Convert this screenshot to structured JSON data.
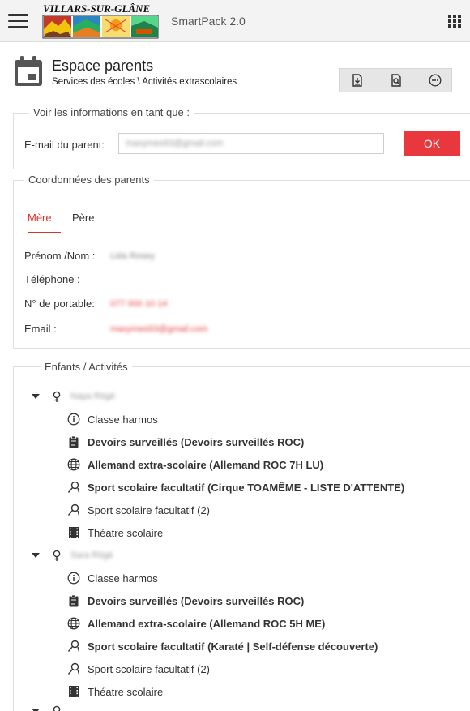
{
  "header": {
    "logo_text": "VILLARS-SUR-GLÂNE",
    "app_title": "SmartPack 2.0"
  },
  "page": {
    "title": "Espace parents",
    "breadcrumb": "Services des écoles \\ Activités extrascolaires"
  },
  "toolbar": {
    "icons": [
      "download-icon",
      "search-document-icon",
      "more-icon"
    ]
  },
  "view_as": {
    "legend": "Voir les informations en tant que :",
    "email_label": "E-mail du parent:",
    "email_value": "maxymes93@gmail.com",
    "ok_label": "OK"
  },
  "parents": {
    "legend": "Coordonnées des parents",
    "tabs": [
      {
        "label": "Mère",
        "active": true
      },
      {
        "label": "Père",
        "active": false
      }
    ],
    "fields": [
      {
        "label": "Prénom /Nom :",
        "value": "Lida Rosey",
        "style": "gray"
      },
      {
        "label": "Téléphone :",
        "value": "",
        "style": "gray"
      },
      {
        "label": "N° de portable:",
        "value": "077 000 10 14",
        "style": "red"
      },
      {
        "label": "Email :",
        "value": "maxymes93@gmail.com",
        "style": "red"
      }
    ]
  },
  "children": {
    "legend": "Enfants / Activités",
    "list": [
      {
        "name": "Naya Rögé",
        "activities": [
          {
            "icon": "info-icon",
            "label": "Classe harmos",
            "bold": false
          },
          {
            "icon": "clipboard-icon",
            "label": "Devoirs surveillés (Devoirs surveillés ROC)",
            "bold": true
          },
          {
            "icon": "globe-icon",
            "label": "Allemand extra-scolaire (Allemand ROC 7H LU)",
            "bold": true
          },
          {
            "icon": "sport-icon",
            "label": "Sport scolaire facultatif (Cirque TOAMÊME - LISTE D'ATTENTE)",
            "bold": true
          },
          {
            "icon": "sport-icon",
            "label": "Sport scolaire facultatif (2)",
            "bold": false
          },
          {
            "icon": "film-icon",
            "label": "Théatre scolaire",
            "bold": false
          }
        ]
      },
      {
        "name": "Sara Rögé",
        "activities": [
          {
            "icon": "info-icon",
            "label": "Classe harmos",
            "bold": false
          },
          {
            "icon": "clipboard-icon",
            "label": "Devoirs surveillés (Devoirs surveillés ROC)",
            "bold": true
          },
          {
            "icon": "globe-icon",
            "label": "Allemand extra-scolaire (Allemand ROC 5H ME)",
            "bold": true
          },
          {
            "icon": "sport-icon",
            "label": "Sport scolaire facultatif (Karaté | Self-défense découverte)",
            "bold": true
          },
          {
            "icon": "sport-icon",
            "label": "Sport scolaire facultatif (2)",
            "bold": false
          },
          {
            "icon": "film-icon",
            "label": "Théatre scolaire",
            "bold": false
          }
        ]
      }
    ]
  },
  "colors": {
    "accent": "#e8383d",
    "tab_active": "#d9342b",
    "topbar": "#f3f3f3"
  }
}
